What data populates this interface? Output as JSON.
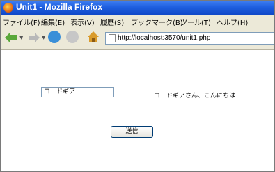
{
  "window": {
    "title": "Unit1 - Mozilla Firefox"
  },
  "menu": [
    "ファイル(F)",
    "編集(E)",
    "表示(V)",
    "履歴(S)",
    "ブックマーク(B)",
    "ツール(T)",
    "ヘルプ(H)"
  ],
  "toolbar": {
    "back_icon": "back-arrow-icon",
    "forward_icon": "forward-arrow-icon",
    "reload_icon": "reload-icon",
    "stop_icon": "stop-icon",
    "home_icon": "home-icon",
    "url": "http://localhost:3570/unit1.php"
  },
  "page": {
    "input_value": "コードギア",
    "greeting": "コードギアさん、こんにちは",
    "submit_label": "送信"
  },
  "colors": {
    "titlebar": "#1f5fe0",
    "chrome": "#ece9d8"
  }
}
